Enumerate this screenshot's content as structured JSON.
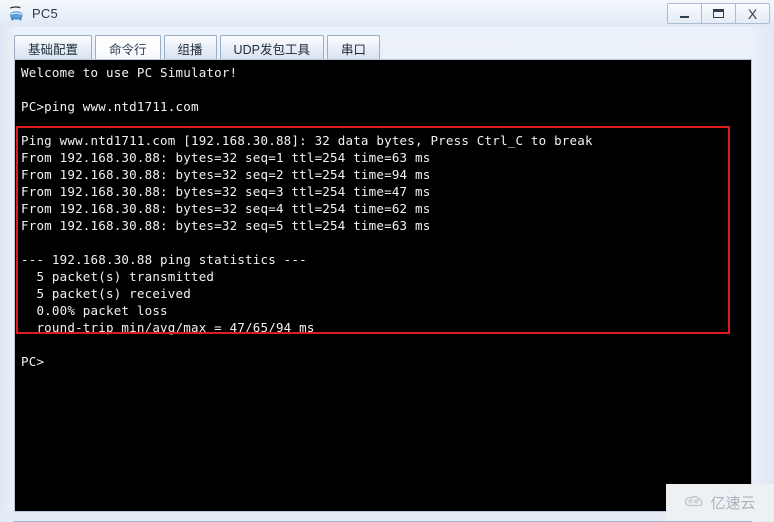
{
  "window": {
    "title": "PC5",
    "app_icon": "pc-device-icon",
    "controls": [
      {
        "name": "minimize-button",
        "glyph": "–",
        "label": "Minimize"
      },
      {
        "name": "maximize-button",
        "glyph": "▭",
        "label": "Maximize"
      },
      {
        "name": "close-button",
        "glyph": "X",
        "label": "Close"
      }
    ]
  },
  "tabs": [
    {
      "label": "基础配置",
      "active": false
    },
    {
      "label": "命令行",
      "active": true
    },
    {
      "label": "组播",
      "active": false
    },
    {
      "label": "UDP发包工具",
      "active": false
    },
    {
      "label": "串口",
      "active": false
    }
  ],
  "terminal": {
    "lines": [
      "Welcome to use PC Simulator!",
      "",
      "PC>ping www.ntd1711.com",
      "",
      "Ping www.ntd1711.com [192.168.30.88]: 32 data bytes, Press Ctrl_C to break",
      "From 192.168.30.88: bytes=32 seq=1 ttl=254 time=63 ms",
      "From 192.168.30.88: bytes=32 seq=2 ttl=254 time=94 ms",
      "From 192.168.30.88: bytes=32 seq=3 ttl=254 time=47 ms",
      "From 192.168.30.88: bytes=32 seq=4 ttl=254 time=62 ms",
      "From 192.168.30.88: bytes=32 seq=5 ttl=254 time=63 ms",
      "",
      "--- 192.168.30.88 ping statistics ---",
      "  5 packet(s) transmitted",
      "  5 packet(s) received",
      "  0.00% packet loss",
      "  round-trip min/avg/max = 47/65/94 ms",
      "",
      "PC>"
    ],
    "background": "#000000",
    "foreground": "#f2f2f2"
  },
  "annotation": {
    "name": "red-highlight-box",
    "color": "#e01b1b"
  },
  "watermark": {
    "text": "亿速云",
    "icon": "cloud-icon"
  }
}
